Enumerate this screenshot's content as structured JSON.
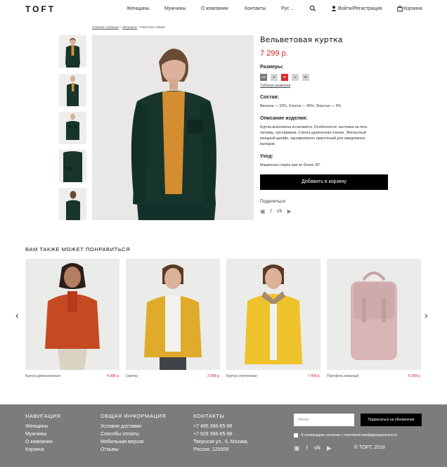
{
  "header": {
    "logo": "TOFT",
    "nav": [
      "Женщины",
      "Мужчины",
      "О компании",
      "Контакты"
    ],
    "language": "Рус",
    "login": "Войти/Регистрация",
    "cart": "Корзина"
  },
  "breadcrumb": {
    "home": "Главная страница",
    "category": "Женщины",
    "separator": ">",
    "current": "Карточка товара"
  },
  "product": {
    "title": "Вельветовая куртка",
    "price": "7 299 р.",
    "sizes_label": "Размеры:",
    "sizes": [
      "XS",
      "S",
      "M",
      "L",
      "XL"
    ],
    "selected_size": "M",
    "size_table_link": "Таблица размеров",
    "composition_label": "Состав:",
    "composition": "Вискоза — 52%, Хлопок — 45%, Эластан — 3%",
    "description_label": "Описание изделия:",
    "description": "Куртка выполнена из вельвета. Особенности: застежка на пять пуговиц, три кармана. Слегка удлиненная спинка. Элегантный изящный дизайн, одновременно практичный для ежедневных выходов.",
    "care_label": "Уход:",
    "care": "Машинная стирка при не более 30°",
    "add_to_cart": "Добавить в корзину",
    "share_label": "Поделиться",
    "colors": {
      "jacket": "#17352a",
      "price": "#d32020"
    }
  },
  "recommendations": {
    "heading": "ВАМ ТАКЖЕ МОЖЕТ ПОНРАВИТЬСЯ",
    "items": [
      {
        "name": "Куртка демисезонная",
        "price": "4 999 р.",
        "color": "#c64a21"
      },
      {
        "name": "Свитер",
        "price": "3 999 р.",
        "color": "#e0aa2a"
      },
      {
        "name": "Куртка утепленная",
        "price": "7 499 р.",
        "color": "#eec22a"
      },
      {
        "name": "Портфель кожаный",
        "price": "6 999 р.",
        "color": "#d9b5b8"
      }
    ]
  },
  "footer": {
    "nav_head": "НАВИГАЦИЯ",
    "nav_links": [
      "Женщины",
      "Мужчины",
      "О компании",
      "Корзина"
    ],
    "info_head": "ОБЩАЯ ИНФОРМАЦИЯ",
    "info_links": [
      "Условия доставки",
      "Способы оплаты",
      "Мобильная версия",
      "Отзывы"
    ],
    "contacts_head": "КОНТАКТЫ",
    "phone1": "+7 495 366-65-96",
    "phone2": "+7 928 366-65-96",
    "address1": "Тверская ул., 6, Москва,",
    "address2": "Россия, 125009",
    "email_placeholder": "Имейл",
    "subscribe": "Подписаться на обновления",
    "consent": "Я потверждаю согласие с политикой конфиденциальности",
    "copyright": "© TOFT, 2018"
  }
}
